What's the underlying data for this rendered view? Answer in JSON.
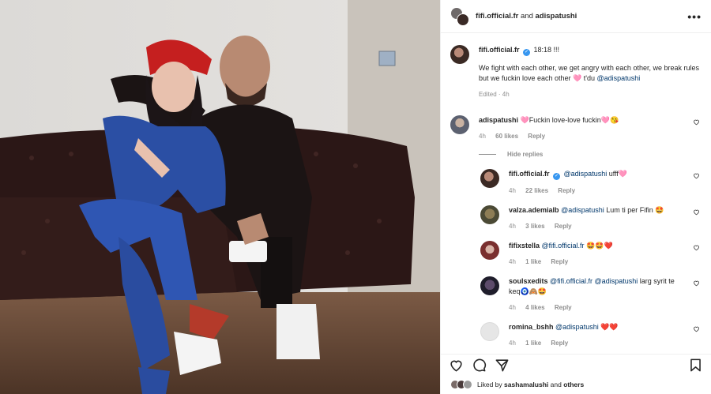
{
  "header": {
    "user1": "fifi.official.fr",
    "and": "and",
    "user2": "adispatushi",
    "more": "•••"
  },
  "caption": {
    "username": "fifi.official.fr",
    "verified": "✓",
    "time": "18:18 !!!",
    "text": "We fight with each other, we get angry with each other, we break rules but we fuckin love each other 🩷 t'du",
    "mention": "@adispatushi",
    "edited": "Edited · 4h"
  },
  "comments": [
    {
      "username": "adispatushi",
      "text": "🩷Fuckin love-love fuckin🩷😘",
      "time": "4h",
      "likes": "60 likes",
      "reply": "Reply"
    }
  ],
  "hide_replies": "Hide replies",
  "replies": [
    {
      "username": "fifi.official.fr",
      "mention": "@adispatushi",
      "text": "ufff🩷",
      "time": "4h",
      "likes": "22 likes",
      "reply": "Reply"
    },
    {
      "username": "valza.ademiaIb",
      "mention": "@adispatushi",
      "text": "Lum ti per Fifin 🤩",
      "time": "4h",
      "likes": "3 likes",
      "reply": "Reply"
    },
    {
      "username": "fifixstella",
      "mention": "@fifi.official.fr",
      "text": "🤩🤩❤️",
      "time": "4h",
      "likes": "1 like",
      "reply": "Reply"
    },
    {
      "username": "soulsxedits",
      "mention": "@fifi.official.fr",
      "mention2": "@adispatushi",
      "text": "larg syrit te keq🧿🙈🤩",
      "time": "4h",
      "likes": "4 likes",
      "reply": "Reply"
    },
    {
      "username": "romina_bshh",
      "mention": "@adispatushi",
      "text": "❤️❤️",
      "time": "4h",
      "likes": "1 like",
      "reply": "Reply"
    }
  ],
  "footer": {
    "liked_by": "Liked by",
    "liker": "sashamalushi",
    "and": "and",
    "others": "others"
  }
}
